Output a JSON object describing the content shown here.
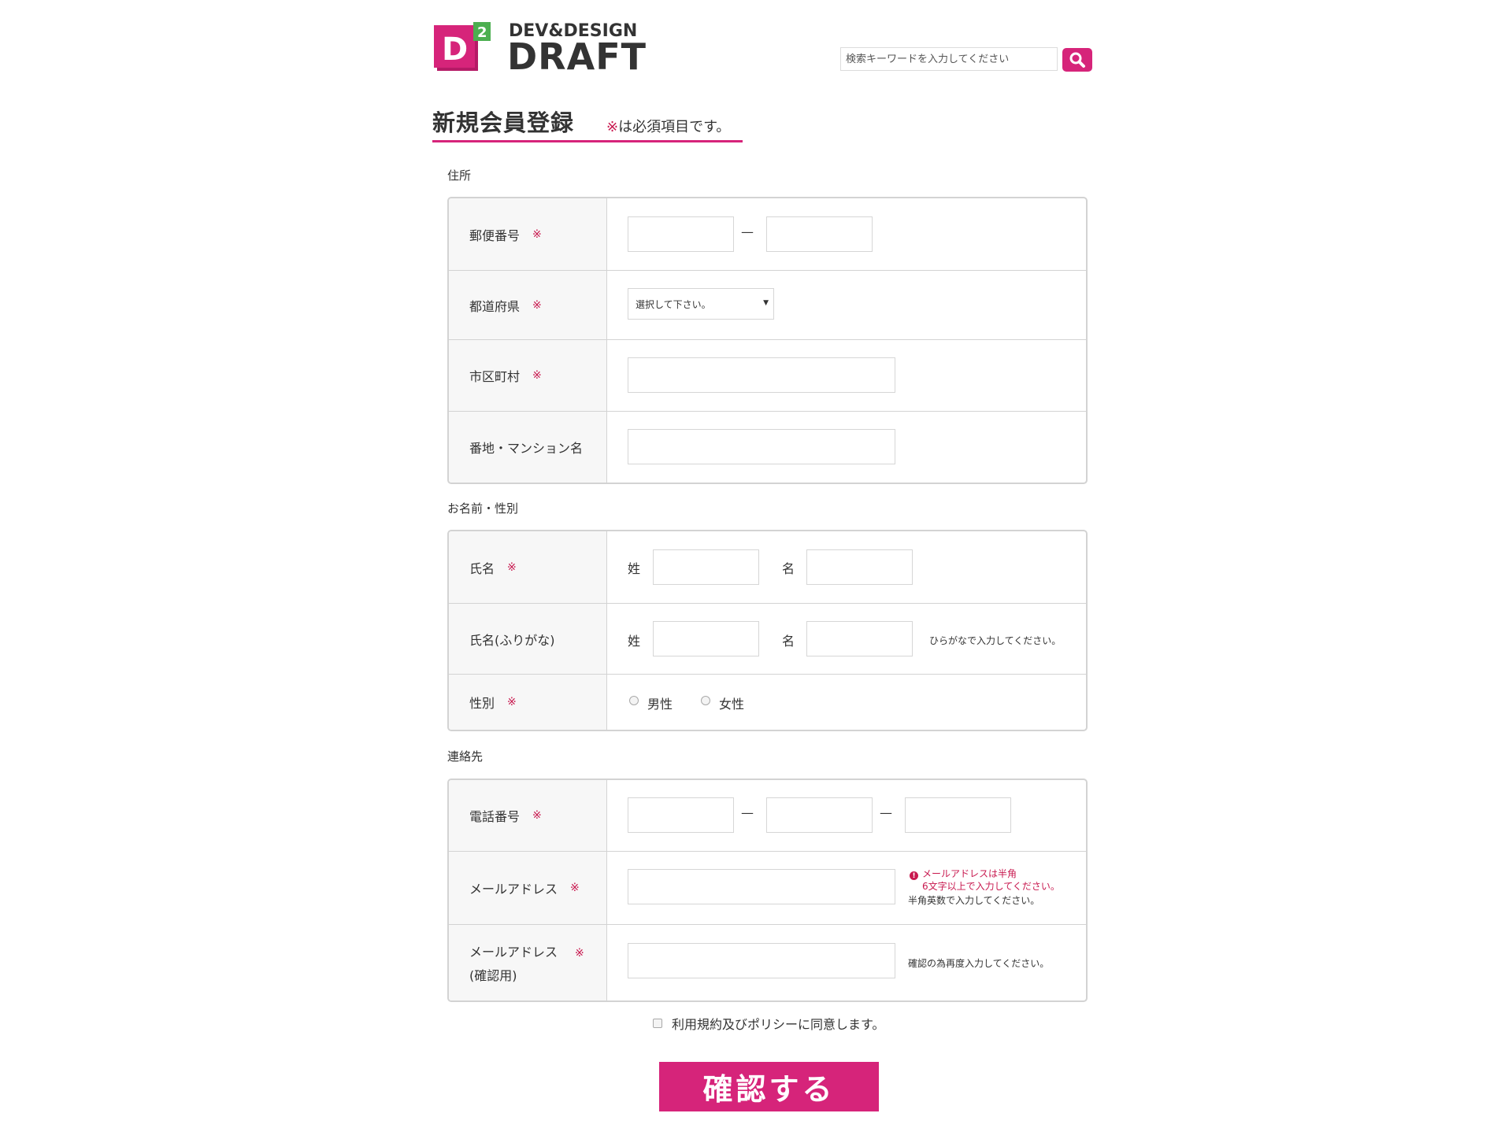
{
  "header": {
    "logo_top": "DEV&DESIGN",
    "logo_main": "DRAFT",
    "logo_badge": "2",
    "logo_letter": "D",
    "search_placeholder": "検索キーワードを入力してください",
    "brand_color": "#d6247a",
    "accent_green": "#4caf50"
  },
  "page": {
    "title": "新規会員登録",
    "required_mark": "※",
    "required_note": "は必須項目です。"
  },
  "sections": {
    "address": {
      "label": "住所",
      "postal_label": "郵便番号",
      "prefecture_label": "都道府県",
      "prefecture_value": "選択して下さい。",
      "city_label": "市区町村",
      "street_label": "番地・マンション名"
    },
    "name": {
      "label": "お名前・性別",
      "fullname_label": "氏名",
      "furigana_label": "氏名(ふりがな)",
      "last": "姓",
      "first": "名",
      "furigana_hint": "ひらがなで入力してください。",
      "gender_label": "性別",
      "male": "男性",
      "female": "女性"
    },
    "contact": {
      "label": "連絡先",
      "phone_label": "電話番号",
      "email_label": "メールアドレス",
      "email_error_line1": "メールアドレスは半角",
      "email_error_line2": "6文字以上で入力してください。",
      "email_hint": "半角英数で入力してください。",
      "email_confirm_label_1": "メールアドレス",
      "email_confirm_label_2": "(確認用)",
      "email_confirm_hint": "確認の為再度入力してください。"
    },
    "dash": "—",
    "req": "※"
  },
  "agree_text": "利用規約及びポリシーに同意します。",
  "submit_label": "確認する"
}
